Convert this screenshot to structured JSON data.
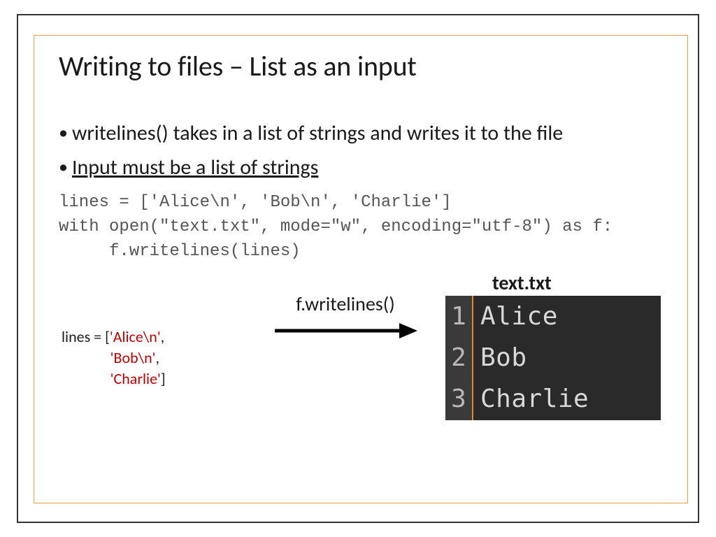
{
  "title": "Writing to files – List as an input",
  "bullets": {
    "b1": "writelines() takes in a list of strings and writes it to the file",
    "b2": "Input must be a list of strings"
  },
  "code": {
    "line1": "lines = ['Alice\\n', 'Bob\\n', 'Charlie']",
    "line2": "with open(\"text.txt\", mode=\"w\", encoding=\"utf-8\") as f:",
    "line3": "     f.writelines(lines)"
  },
  "diagram": {
    "lines_prefix": "lines = [",
    "item1": "'Alice\\n'",
    "comma": ",",
    "item2": "'Bob\\n'",
    "item3": "'Charlie'",
    "close": "]",
    "arrow_label": "f.writelines()",
    "file_label": "text.txt"
  },
  "editor": {
    "ln1": "1",
    "ln2": "2",
    "ln3": "3",
    "t1": "Alice",
    "t2": "Bob",
    "t3": "Charlie"
  }
}
